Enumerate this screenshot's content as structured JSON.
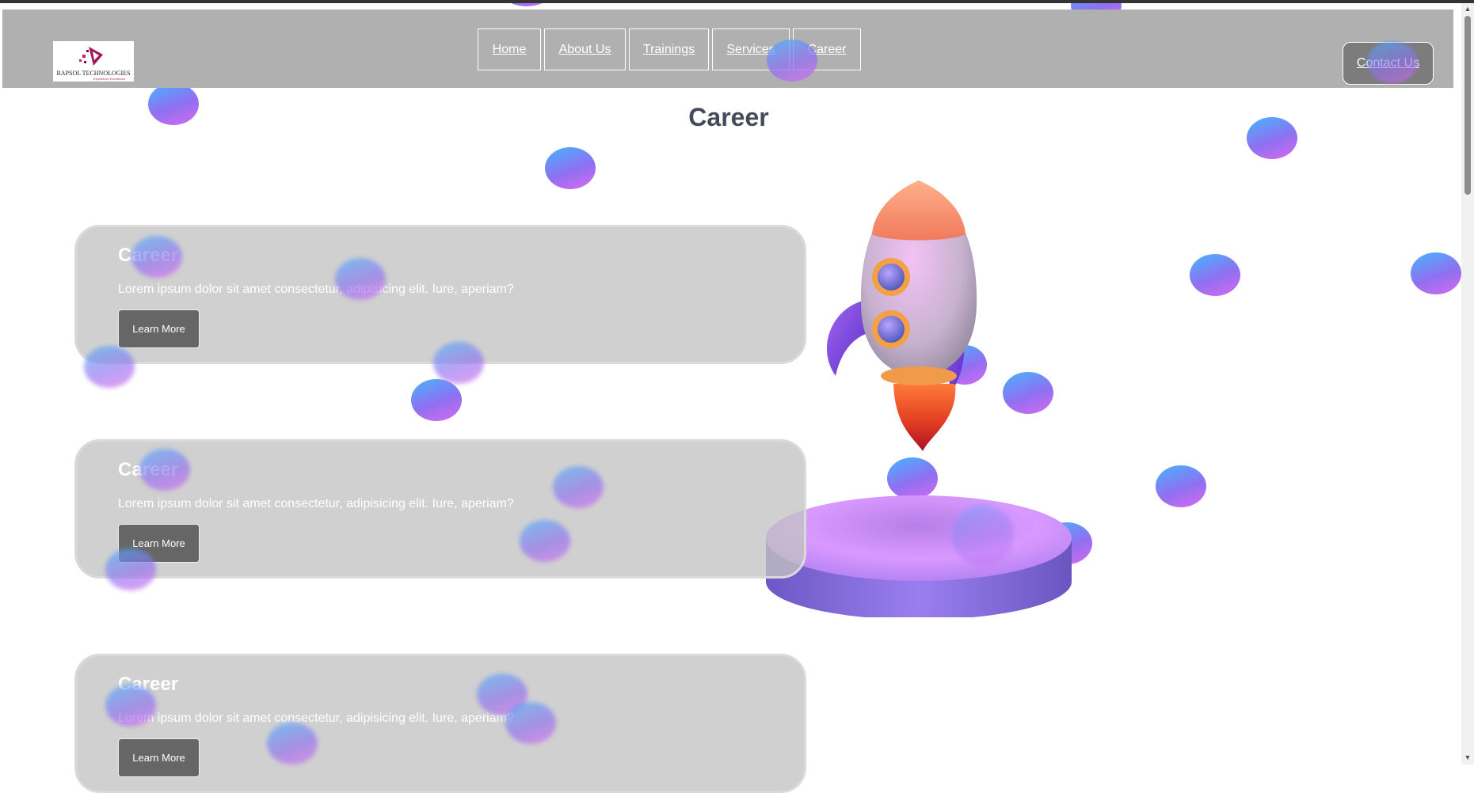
{
  "header": {
    "logo": {
      "brand": "RAPSOL TECHNOLOGIES",
      "tagline": "Experience Excellence"
    },
    "nav": [
      {
        "label": "Home"
      },
      {
        "label": "About Us"
      },
      {
        "label": "Trainings"
      },
      {
        "label": "Services"
      },
      {
        "label": "Career"
      }
    ],
    "contact_label": "Contact Us"
  },
  "page": {
    "title": "Career"
  },
  "cards": [
    {
      "title": "Career",
      "text": "Lorem ipsum dolor sit amet consectetur, adipisicing elit. Iure, aperiam?",
      "button": "Learn More"
    },
    {
      "title": "Career",
      "text": "Lorem ipsum dolor sit amet consectetur, adipisicing elit. Iure, aperiam?",
      "button": "Learn More"
    },
    {
      "title": "Career",
      "text": "Lorem ipsum dolor sit amet consectetur, adipisicing elit. Iure, aperiam?",
      "button": "Learn More"
    }
  ],
  "colors": {
    "header_bg": "#b0b0b0",
    "title_text": "#454a5a",
    "card_bg": "#c3c3c3",
    "button_bg": "#666666",
    "bubble_start": "#46b4ff",
    "bubble_end": "#d86af2"
  },
  "icons": [
    "logo-icon",
    "rocket-illustration",
    "bubble-decoration",
    "scroll-up-icon",
    "scroll-down-icon"
  ]
}
